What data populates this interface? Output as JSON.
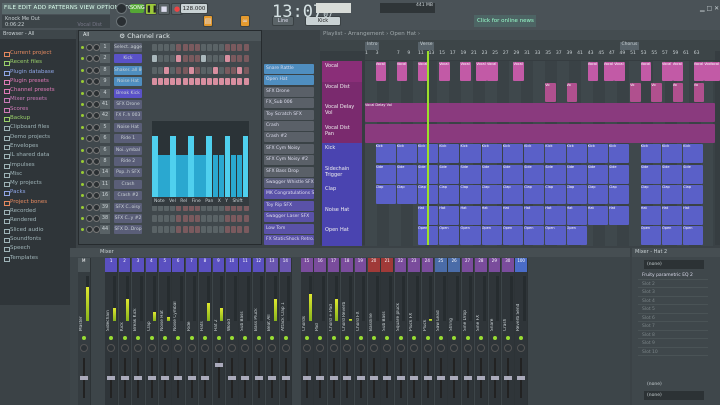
{
  "menu": "FILE EDIT ADD PATTERNS VIEW OPTIONS TOOLS HELP",
  "song": {
    "title": "Knock Me Out",
    "time": "0:06:22",
    "hint": "Vocal Dist"
  },
  "transport": {
    "mode": "SONG",
    "tempo": "128.000",
    "clock": "13:07",
    "clock_sub": "07",
    "cpu": "441 MB"
  },
  "toolbar": {
    "pattern": "Kick",
    "snap": "Line",
    "news": "Click for online news"
  },
  "browser": {
    "title": "Browser - All",
    "items": [
      {
        "label": "Current project",
        "color": "#e68a60"
      },
      {
        "label": "Recent files",
        "color": "#9ad06a"
      },
      {
        "label": "Plugin database",
        "color": "#8fa6e8"
      },
      {
        "label": "Plugin presets",
        "color": "#e07ab8"
      },
      {
        "label": "Channel presets",
        "color": "#e07ab8"
      },
      {
        "label": "Mixer presets",
        "color": "#c87ab8"
      },
      {
        "label": "Scores",
        "color": "#d07ab8"
      },
      {
        "label": "Backup",
        "color": "#9ad06a"
      },
      {
        "label": "Clipboard files",
        "color": "#9fb4b8"
      },
      {
        "label": "Demo projects",
        "color": "#9fb4b8"
      },
      {
        "label": "Envelopes",
        "color": "#9fb4b8"
      },
      {
        "label": "IL shared data",
        "color": "#9fb4b8"
      },
      {
        "label": "Impulses",
        "color": "#9fb4b8"
      },
      {
        "label": "Misc",
        "color": "#9fb4b8"
      },
      {
        "label": "My projects",
        "color": "#9fb4b8"
      },
      {
        "label": "Packs",
        "color": "#8fa6e8"
      },
      {
        "label": "Project bones",
        "color": "#e68a60"
      },
      {
        "label": "Recorded",
        "color": "#9fb4b8"
      },
      {
        "label": "Rendered",
        "color": "#9fb4b8"
      },
      {
        "label": "Sliced audio",
        "color": "#9fb4b8"
      },
      {
        "label": "Soundfonts",
        "color": "#9fb4b8"
      },
      {
        "label": "Speech",
        "color": "#9fb4b8"
      },
      {
        "label": "Templates",
        "color": "#9fb4b8"
      }
    ]
  },
  "channel_rack": {
    "title": "Channel rack",
    "filter": "All",
    "channels": [
      {
        "num": "1",
        "name": "Select..agger",
        "color": "#5a6070"
      },
      {
        "num": "2",
        "name": "Kick",
        "color": "#5a52c8"
      },
      {
        "num": "8",
        "name": "Shaker..all 86",
        "color": "#4f8ec0"
      },
      {
        "num": "9",
        "name": "Noise Hat",
        "color": "#4f8ec0"
      },
      {
        "num": "4",
        "name": "Break Kick",
        "color": "#5a52c8"
      },
      {
        "num": "41",
        "name": "SFX Drone",
        "color": "#5a5e78"
      },
      {
        "num": "42",
        "name": "FX F..h 003",
        "color": "#5a5e78"
      },
      {
        "num": "5",
        "name": "Noise Hat",
        "color": "#5a5e78"
      },
      {
        "num": "6",
        "name": "Ride 1",
        "color": "#5a5e78"
      },
      {
        "num": "6",
        "name": "Noi..ymbal",
        "color": "#5a5e78"
      },
      {
        "num": "8",
        "name": "Ride 2",
        "color": "#5a5e78"
      },
      {
        "num": "14",
        "name": "Pop..h SFX",
        "color": "#5a5e78"
      },
      {
        "num": "11",
        "name": "Crash",
        "color": "#5a5e78"
      },
      {
        "num": "16",
        "name": "Crash #2",
        "color": "#5a5e78"
      },
      {
        "num": "39",
        "name": "SFX C..oisy",
        "color": "#5a5e78"
      },
      {
        "num": "38",
        "name": "SFX C..y #2",
        "color": "#5a5e78"
      },
      {
        "num": "44",
        "name": "SFX D..Drop",
        "color": "#5a5e78"
      }
    ],
    "graph_tabs": "Note Vel Rel Fine Pan X Y Shift",
    "velocities": [
      0.8,
      0.55,
      0.55,
      0.8,
      0.55,
      0.55,
      0.8,
      0.55,
      0.55,
      0.8,
      0.55,
      0.55,
      0.8,
      0.55,
      0.55,
      0.8
    ]
  },
  "picker": [
    {
      "name": "Snare Rattle",
      "color": "#4f8ec0"
    },
    {
      "name": "Open Hat",
      "color": "#4f8ec0"
    },
    {
      "name": "SFX Drone",
      "color": "#5a6068"
    },
    {
      "name": "FX_Sub 006",
      "color": "#5a6068"
    },
    {
      "name": "Toy Scratch SFX",
      "color": "#5a6068"
    },
    {
      "name": "Crash",
      "color": "#5a6068"
    },
    {
      "name": "Crash #2",
      "color": "#5a6068"
    },
    {
      "name": "SFX Cym Noisy",
      "color": "#5a6068"
    },
    {
      "name": "SFX Cym Noisy #2",
      "color": "#5a6068"
    },
    {
      "name": "SFX Bass Drop",
      "color": "#5a6068"
    },
    {
      "name": "Swagger Whistle SFX",
      "color": "#5a5e78"
    },
    {
      "name": "MK Congratulations Sh...",
      "color": "#5a52a8"
    },
    {
      "name": "Toy Rip SFX",
      "color": "#5a52a8"
    },
    {
      "name": "Swagger Laser SFX",
      "color": "#5a52a8"
    },
    {
      "name": "Low Tom",
      "color": "#5a52a8"
    },
    {
      "name": "FX StaticShock Retro...",
      "color": "#5a52a8"
    }
  ],
  "playlist": {
    "title": "Playlist - Arrangement › Open Hat ›",
    "bars": [
      "1",
      "3",
      "7",
      "9",
      "11",
      "13",
      "15",
      "17",
      "19",
      "21",
      "23",
      "25",
      "27",
      "29",
      "31",
      "33",
      "35",
      "37",
      "39",
      "41",
      "43",
      "45",
      "47",
      "49",
      "51",
      "53",
      "55",
      "57",
      "59",
      "61",
      "63"
    ],
    "markers": [
      {
        "label": "Intro",
        "bar": 1
      },
      {
        "label": "Verse",
        "bar": 11
      },
      {
        "label": "Chorus",
        "bar": 49
      }
    ],
    "tracks": [
      {
        "name": "Vocal",
        "color": "#8a2e78",
        "clipcolor": "#c25aa6",
        "clips": [
          3,
          7,
          11,
          15,
          19,
          22,
          24,
          29,
          43,
          46,
          48,
          53,
          57,
          59,
          63,
          65,
          66
        ],
        "clip_label": "Vocal"
      },
      {
        "name": "Vocal Dist",
        "color": "#7a2a6e",
        "clipcolor": "#b0508e",
        "clips": [
          35,
          39,
          51,
          55,
          59,
          63
        ],
        "clip_label": "Vo"
      },
      {
        "name": "Vocal Delay Vol",
        "color": "#7a2a6e",
        "clipcolor": "#8a3a7e",
        "clips": [],
        "clip_label": "Vocal Delay Vol"
      },
      {
        "name": "Vocal Dist Pan",
        "color": "#7a2a6e",
        "clipcolor": "#8a3a7e",
        "clips": [],
        "clip_label": ""
      },
      {
        "name": "Kick",
        "color": "#4a44b0",
        "clipcolor": "#5a60c8",
        "clips": [
          3,
          7,
          11,
          15,
          19,
          23,
          27,
          31,
          35,
          39,
          43,
          47,
          53,
          57,
          61
        ],
        "clip_label": "Kick"
      },
      {
        "name": "Sidechain Trigger",
        "color": "#4a44b0",
        "clipcolor": "#5a60c8",
        "clips": [
          3,
          7,
          11,
          15,
          19,
          23,
          27,
          31,
          35,
          39,
          43,
          47,
          53,
          57,
          61
        ],
        "clip_label": "Side"
      },
      {
        "name": "Clap",
        "color": "#4a44b0",
        "clipcolor": "#5a60c8",
        "clips": [
          3,
          7,
          11,
          15,
          19,
          23,
          27,
          31,
          35,
          39,
          43,
          47,
          53,
          57,
          61
        ],
        "clip_label": "Clap"
      },
      {
        "name": "Noise Hat",
        "color": "#4a44b0",
        "clipcolor": "#5a60c8",
        "clips": [
          11,
          15,
          19,
          23,
          27,
          31,
          35,
          39,
          43,
          47,
          53,
          57,
          61
        ],
        "clip_label": "Hat"
      },
      {
        "name": "Open Hat",
        "color": "#4a44b0",
        "clipcolor": "#5a60c8",
        "clips": [
          11,
          15,
          19,
          23,
          27,
          31,
          35,
          39,
          53,
          57,
          61
        ],
        "clip_label": "Open"
      }
    ]
  },
  "mixer": {
    "title": "Mixer",
    "strips": [
      {
        "n": "M",
        "name": "Master",
        "level": 0.75,
        "color": "#4b5458"
      },
      {
        "n": "1",
        "name": "Sidechain",
        "level": 0.3,
        "color": "#5a50c0"
      },
      {
        "n": "2",
        "name": "Kick",
        "level": 0.5,
        "color": "#5a50c0"
      },
      {
        "n": "3",
        "name": "Break Kick",
        "level": 0,
        "color": "#5a50c0"
      },
      {
        "n": "4",
        "name": "Clap",
        "level": 0.2,
        "color": "#5a50c0"
      },
      {
        "n": "5",
        "name": "Noise Hat",
        "level": 0.1,
        "color": "#5a50c0"
      },
      {
        "n": "6",
        "name": "Noise Cymbal",
        "level": 0,
        "color": "#5a50c0"
      },
      {
        "n": "7",
        "name": "Ride",
        "level": 0,
        "color": "#5a50c0"
      },
      {
        "n": "8",
        "name": "Hats",
        "level": 0.4,
        "color": "#5a50c0"
      },
      {
        "n": "9",
        "name": "Hat 2",
        "level": 0.3,
        "color": "#5a50c0"
      },
      {
        "n": "10",
        "name": "Wood",
        "level": 0,
        "color": "#5a50c0"
      },
      {
        "n": "11",
        "name": "Sub Bass",
        "level": 0,
        "color": "#5a50c0"
      },
      {
        "n": "12",
        "name": "Bass Pluck",
        "level": 0,
        "color": "#5a50c0"
      },
      {
        "n": "13",
        "name": "Beat All",
        "level": 0.5,
        "color": "#6a56b0"
      },
      {
        "n": "14",
        "name": "Attack Clap 1",
        "level": 0,
        "color": "#6a56b0"
      },
      {
        "n": "15",
        "name": "Chords",
        "level": 0.6,
        "color": "#7a4c9c"
      },
      {
        "n": "16",
        "name": "Pad",
        "level": 0,
        "color": "#7a4c9c"
      },
      {
        "n": "17",
        "name": "Chord + Pad",
        "level": 0.5,
        "color": "#7a4c9c"
      },
      {
        "n": "18",
        "name": "Chord Reverb",
        "level": 0.05,
        "color": "#7a4c9c"
      },
      {
        "n": "19",
        "name": "Chord FX",
        "level": 0,
        "color": "#7a4c9c"
      },
      {
        "n": "20",
        "name": "Bassline",
        "level": 0,
        "color": "#a03a38"
      },
      {
        "n": "21",
        "name": "Sub Bass",
        "level": 0,
        "color": "#a03a38"
      },
      {
        "n": "22",
        "name": "Square pluck",
        "level": 0,
        "color": "#7a4c9c"
      },
      {
        "n": "23",
        "name": "Pluck FX",
        "level": 0,
        "color": "#7a4c9c"
      },
      {
        "n": "24",
        "name": "Pluck",
        "level": 0.05,
        "color": "#7a4c9c"
      },
      {
        "n": "25",
        "name": "Saw Lead",
        "level": 0,
        "color": "#4a6ca8"
      },
      {
        "n": "26",
        "name": "String",
        "level": 0,
        "color": "#4a6ca8"
      },
      {
        "n": "27",
        "name": "Sine Drop",
        "level": 0,
        "color": "#7a4c9c"
      },
      {
        "n": "28",
        "name": "Sine FX",
        "level": 0,
        "color": "#7a4c9c"
      },
      {
        "n": "29",
        "name": "Snare",
        "level": 0,
        "color": "#7a4c9c"
      },
      {
        "n": "30",
        "name": "Crash",
        "level": 0,
        "color": "#7a4c9c"
      },
      {
        "n": "100",
        "name": "Reverb Send",
        "level": 0,
        "color": "#4a6cc8"
      }
    ]
  },
  "insert": {
    "title": "Mixer - Hat 2",
    "input": "(none)",
    "output": "(none)",
    "slots": [
      "Fruity parametric EQ 2",
      "Slot 2",
      "Slot 3",
      "Slot 4",
      "Slot 5",
      "Slot 6",
      "Slot 7",
      "Slot 8",
      "Slot 9",
      "Slot 10"
    ]
  }
}
